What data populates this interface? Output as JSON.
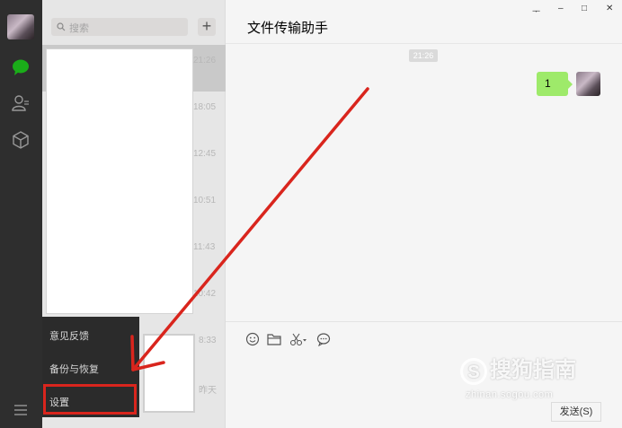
{
  "search": {
    "placeholder": "搜索"
  },
  "chat": {
    "title": "文件传输助手",
    "time_chip": "21:26",
    "message": "1"
  },
  "list_times": [
    "21:26",
    "18:05",
    "12:45",
    "10:51",
    "11:43",
    "10:42",
    "8:33",
    "昨天"
  ],
  "menu": {
    "items": [
      "意见反馈",
      "备份与恢复",
      "设置"
    ]
  },
  "window_controls": {
    "pin": "ᅮ",
    "minimize": "–",
    "maximize": "□",
    "close": "✕"
  },
  "send_label": "发送(S)",
  "watermark": {
    "logo": "搜狗指南",
    "url": "zhinan.sogou.com"
  },
  "colors": {
    "accent": "#1aad19",
    "bubble": "#9eea6a",
    "annotation": "#d9251d"
  }
}
